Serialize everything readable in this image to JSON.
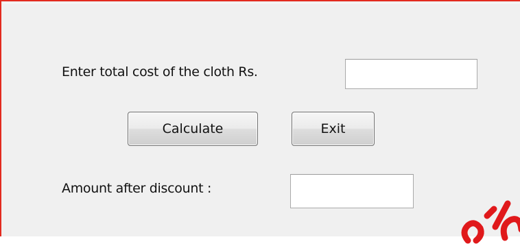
{
  "form": {
    "cost_label": "Enter total cost of the cloth Rs.",
    "cost_value": "",
    "calculate_label": "Calculate",
    "exit_label": "Exit",
    "amount_label": "Amount after discount :",
    "amount_value": ""
  },
  "colors": {
    "window_border": "#e32a1f",
    "background": "#f0f0f0",
    "watermark": "#e0191b"
  }
}
